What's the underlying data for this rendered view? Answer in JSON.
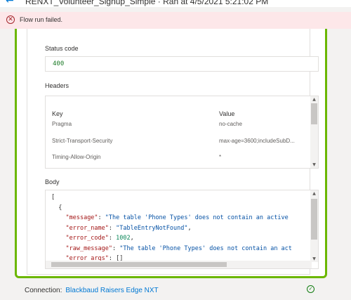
{
  "header": {
    "back_icon": "back-arrow-icon",
    "title": "RENXT_Volunteer_Signup_Simple · Ran at 4/5/2021 5:21:02 PM"
  },
  "error_bar": {
    "icon": "error-circle-icon",
    "message": "Flow run failed."
  },
  "status": {
    "label": "Status code",
    "value": "400"
  },
  "headers": {
    "label": "Headers",
    "col_key": "Key",
    "col_value": "Value",
    "rows": [
      {
        "key": "Pragma",
        "value": "no-cache"
      },
      {
        "key": "Strict-Transport-Security",
        "value": "max-age=3600;includeSubD..."
      },
      {
        "key": "Timing-Allow-Origin",
        "value": "*"
      }
    ]
  },
  "body": {
    "label": "Body",
    "lines": {
      "l0": "[",
      "l1": "  {",
      "l2_key": "\"message\"",
      "l2_val": "\"The table 'Phone Types' does not contain an active",
      "l3_key": "\"error_name\"",
      "l3_val": "\"TableEntryNotFound\"",
      "l4_key": "\"error_code\"",
      "l4_val": "1002",
      "l5_key": "\"raw_message\"",
      "l5_val": "\"The table 'Phone Types' does not contain an act",
      "l6_key": "\"error_args\"",
      "l6_val": "[]"
    }
  },
  "footer": {
    "connection_label": "Connection:",
    "connection_name": "Blackbaud Raisers Edge NXT",
    "status_icon": "success-check-icon"
  },
  "colors": {
    "success_green": "#6bb700",
    "error_bg": "#fde7e9",
    "link_blue": "#0078d4"
  }
}
